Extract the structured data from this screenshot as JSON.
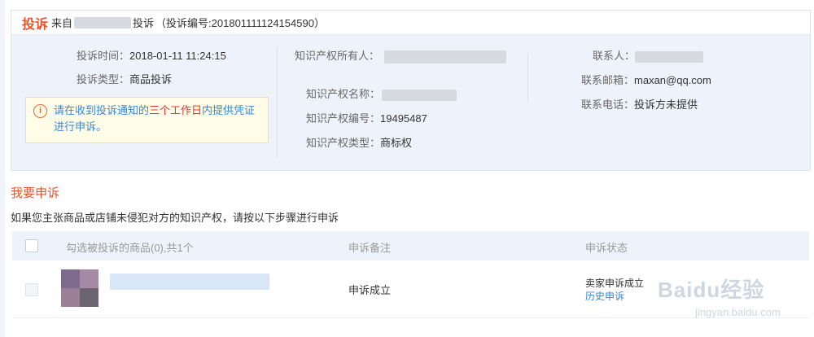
{
  "complaint": {
    "tag": "投诉",
    "source_prefix": "来自",
    "source_suffix": "投诉",
    "number_text": "（投诉编号:201801111124154590）",
    "time_label": "投诉时间：",
    "time_value": "2018-01-11 11:24:15",
    "type_label": "投诉类型：",
    "type_value": "商品投诉",
    "owner_label": "知识产权所有人：",
    "ip_name_label": "知识产权名称：",
    "ip_number_label": "知识产权编号：",
    "ip_number_value": "19495487",
    "ip_type_label": "知识产权类型：",
    "ip_type_value": "商标权",
    "contact_label": "联系人：",
    "email_label": "联系邮箱：",
    "email_value": "maxan@qq.com",
    "phone_label": "联系电话：",
    "phone_value": "投诉方未提供",
    "notice_icon": "info-icon",
    "notice_part1": "请在收到投诉通知的",
    "notice_highlight": "三个工作日",
    "notice_part2": "内提供凭证进行申诉。"
  },
  "appeal": {
    "title": "我要申诉",
    "description": "如果您主张商品或店铺未侵犯对方的知识产权，请按以下步骤进行申诉",
    "columns": {
      "goods": "勾选被投诉的商品(0),共1个",
      "note": "申诉备注",
      "status": "申诉状态"
    },
    "rows": [
      {
        "note": "申诉成立",
        "status": "卖家申诉成立",
        "history_link": "历史申诉"
      }
    ]
  },
  "watermark": {
    "logo": "Baidu经验",
    "url": "jingyan.baidu.com"
  },
  "colors": {
    "accent_orange": "#e8542d",
    "link_blue": "#3b86d0",
    "panel_bg": "#eef3fb",
    "notice_bg": "#fffde7"
  }
}
